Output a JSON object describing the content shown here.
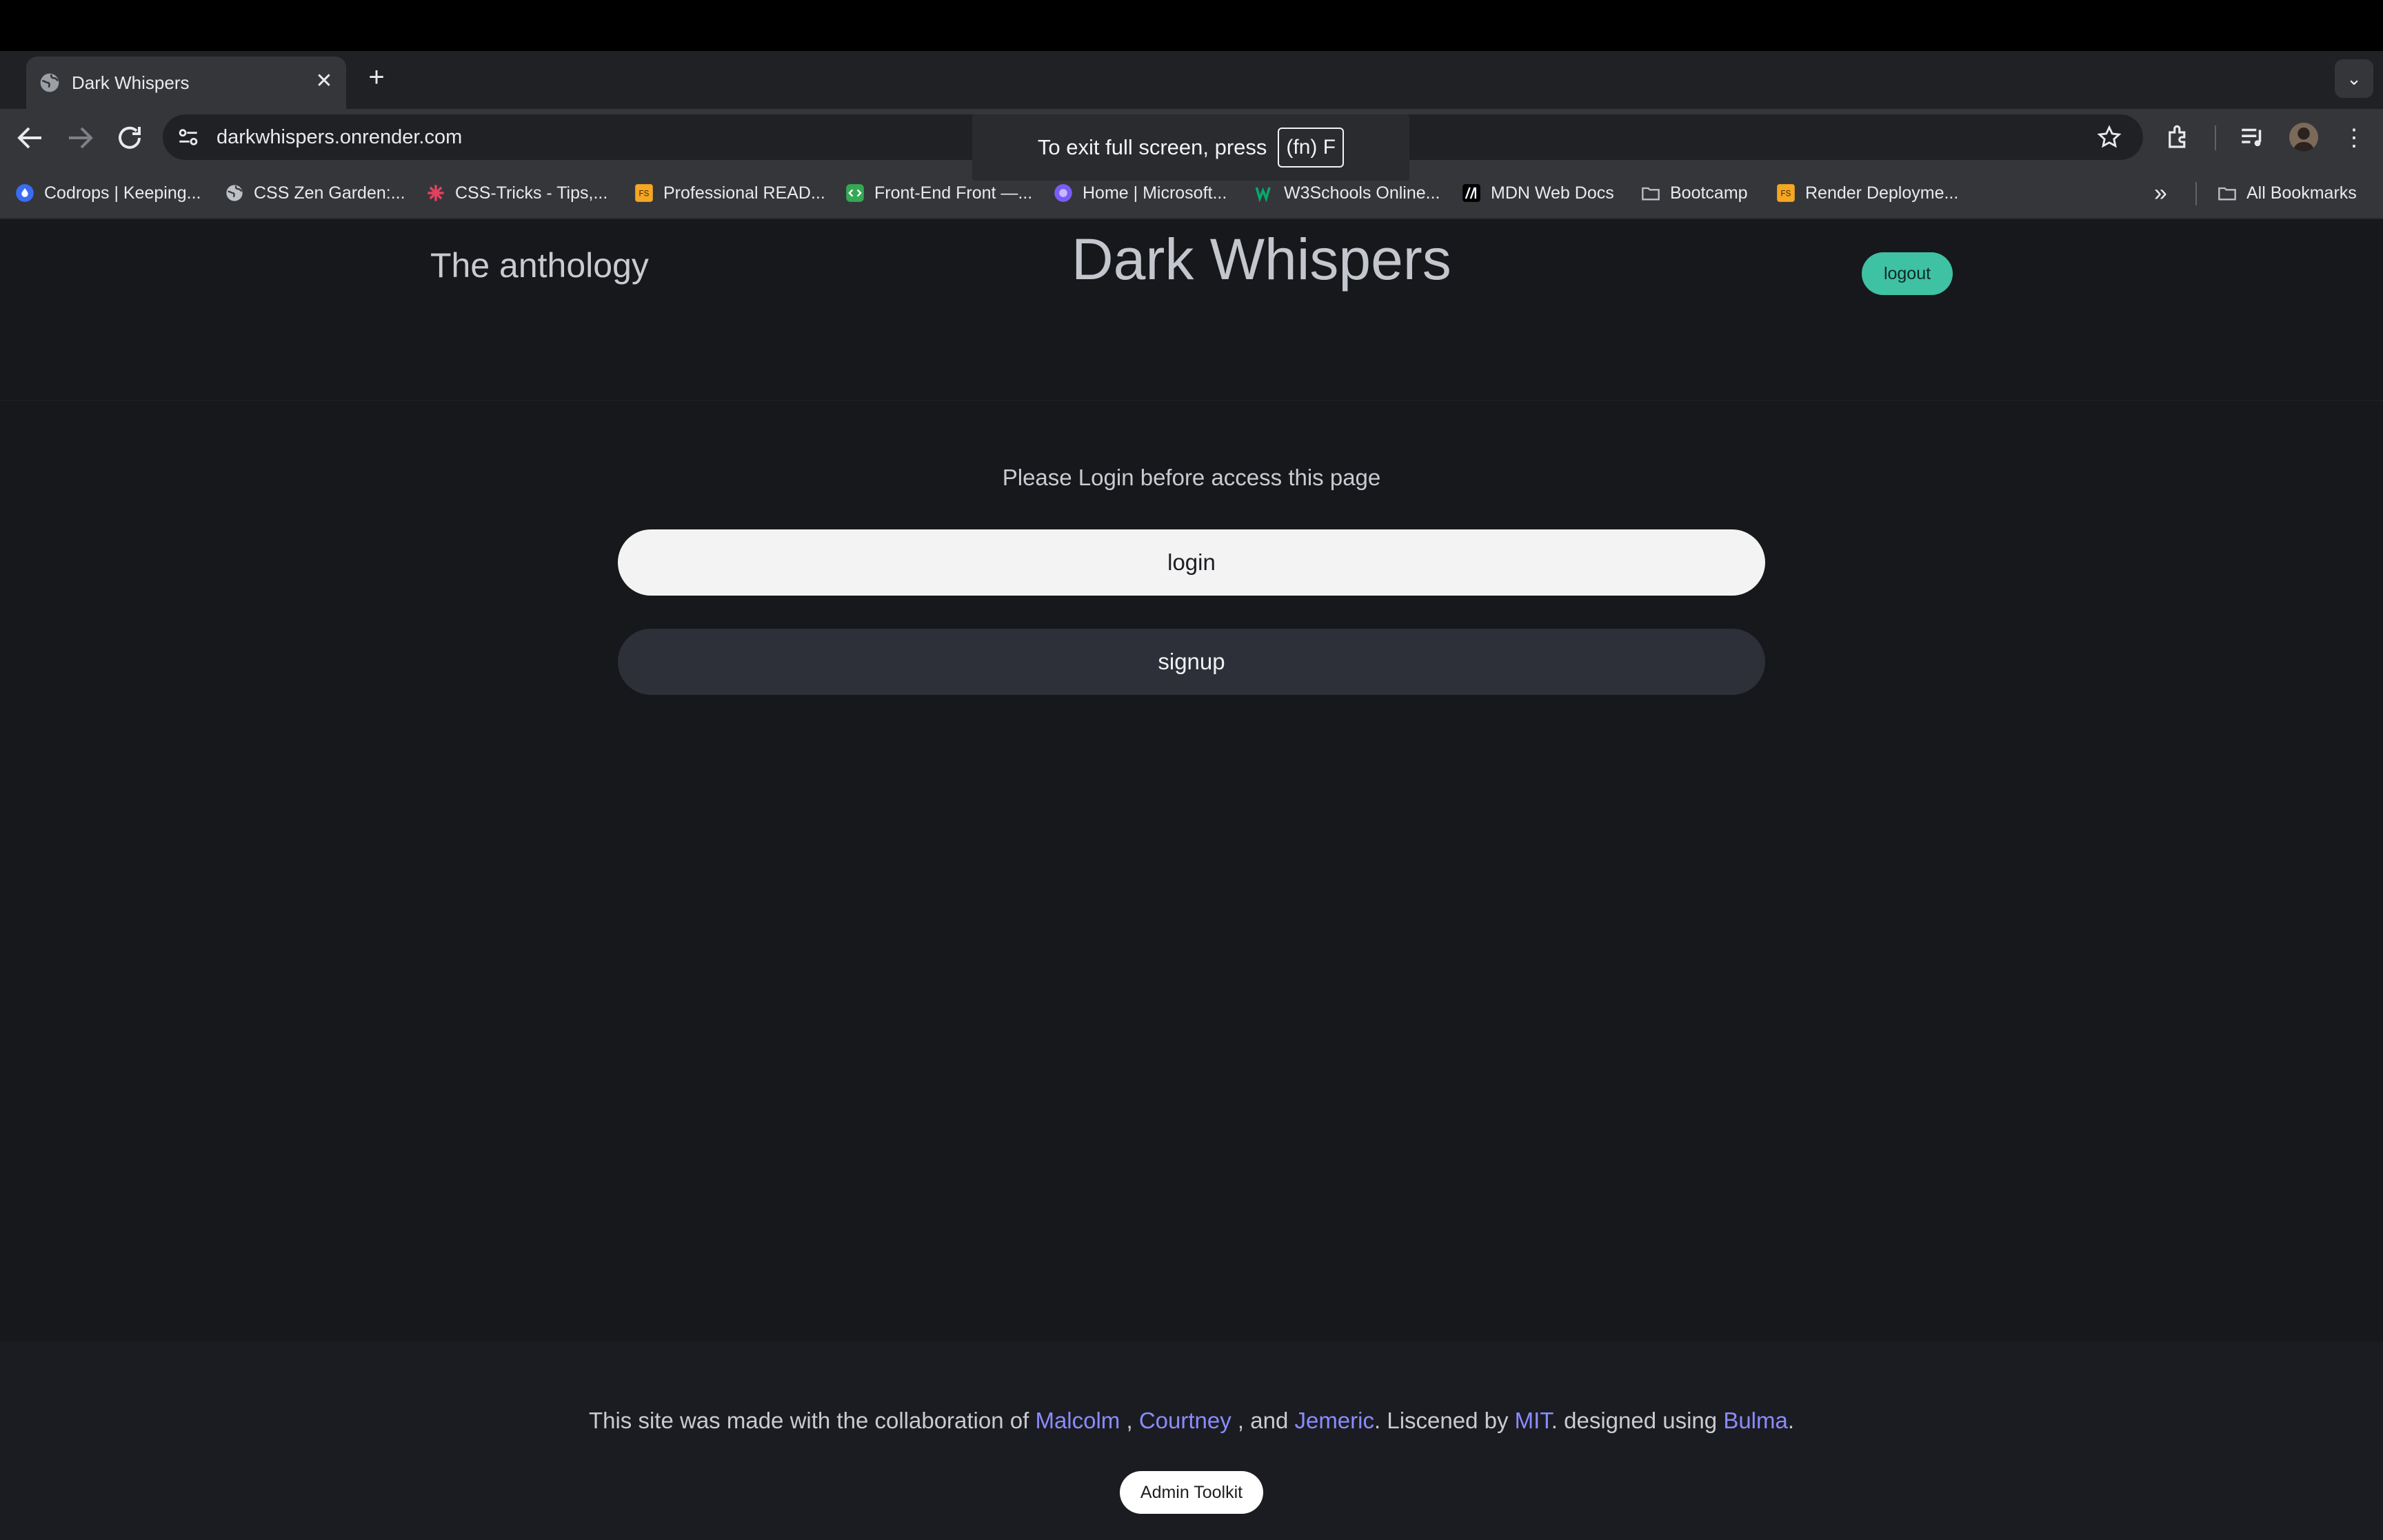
{
  "browser": {
    "tab_title": "Dark Whispers",
    "url": "darkwhispers.onrender.com",
    "fullscreen_notice": "To exit full screen, press",
    "fullscreen_key": "(fn) F",
    "bookmarks": [
      {
        "label": "Codrops | Keeping...",
        "icon": "codrops-icon",
        "color": "#3b6cf6"
      },
      {
        "label": "CSS Zen Garden:...",
        "icon": "globe-icon",
        "color": "#bdc1c6"
      },
      {
        "label": "CSS-Tricks - Tips,...",
        "icon": "css-tricks-icon",
        "color": "#e4405f"
      },
      {
        "label": "Professional READ...",
        "icon": "fs-icon",
        "color": "#f5a623"
      },
      {
        "label": "Front-End Front —...",
        "icon": "frontend-icon",
        "color": "#34a853"
      },
      {
        "label": "Home | Microsoft...",
        "icon": "microsoft-icon",
        "color": "#7b5cf6"
      },
      {
        "label": "W3Schools Online...",
        "icon": "w3schools-icon",
        "color": "#04aa6d"
      },
      {
        "label": "MDN Web Docs",
        "icon": "mdn-icon",
        "color": "#ffffff"
      },
      {
        "label": "Bootcamp",
        "icon": "folder-icon",
        "color": "#bdc1c6"
      },
      {
        "label": "Render Deployme...",
        "icon": "fs-icon",
        "color": "#f5a623"
      }
    ],
    "all_bookmarks": "All Bookmarks"
  },
  "header": {
    "subtitle": "The anthology",
    "title": "Dark Whispers",
    "logout_label": "logout"
  },
  "main": {
    "notice": "Please Login before access this page",
    "login_label": "login",
    "signup_label": "signup"
  },
  "footer": {
    "prefix": "This site was made with the collaboration of ",
    "author1": "Malcolm",
    "sep1": " , ",
    "author2": "Courtney",
    "sep2": " , and ",
    "author3": "Jemeric",
    "mid": ". Liscened by ",
    "license": "MIT",
    "mid2": ". designed using ",
    "framework": "Bulma",
    "end": ".",
    "admin_label": "Admin Toolkit"
  },
  "colors": {
    "accent_logout": "#3fc1a4",
    "link": "#8a8cff",
    "page_bg": "#17181c"
  }
}
